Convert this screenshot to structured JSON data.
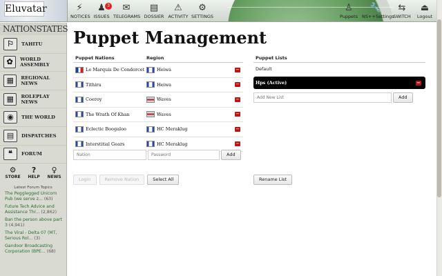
{
  "topbar": {
    "nation_name": "Eluvatar",
    "nav": [
      {
        "label": "NOTICES",
        "icon": "⚡"
      },
      {
        "label": "ISSUES",
        "icon": "♟",
        "badge": "3"
      },
      {
        "label": "TELEGRAMS",
        "icon": "✉"
      },
      {
        "label": "DOSSIER",
        "icon": "▤"
      },
      {
        "label": "ACTIVITY",
        "icon": "⚠"
      },
      {
        "label": "SETTINGS",
        "icon": "⚙"
      }
    ],
    "right_nav": [
      {
        "label": "Puppets",
        "icon": "♙"
      },
      {
        "label": "NS++Settings",
        "icon": "🔧"
      },
      {
        "label": "SWITCH",
        "icon": "⇆"
      },
      {
        "label": "Logout",
        "icon": "⏏"
      }
    ]
  },
  "sidebar": {
    "logo": "NATIONSTATES",
    "items": [
      {
        "label": "TAHITU",
        "icon": "⚐"
      },
      {
        "label": "WORLD ASSEMBLY",
        "icon": "✿"
      },
      {
        "label": "REGIONAL NEWS",
        "icon": "▦"
      },
      {
        "label": "ROLEPLAY NEWS",
        "icon": "▦"
      },
      {
        "label": "THE WORLD",
        "icon": "◉"
      },
      {
        "label": "DISPATCHES",
        "icon": "▤"
      },
      {
        "label": "FORUM",
        "icon": "❝"
      }
    ],
    "tools": [
      {
        "label": "STORE",
        "icon": "⚙"
      },
      {
        "label": "HELP",
        "icon": "?"
      },
      {
        "label": "NEWS",
        "icon": "♀"
      }
    ],
    "forum_heading": "Latest Forum Topics",
    "topics": [
      {
        "title": "The Pegglegged Unicorn Pub (we serve z...",
        "count": "(63)"
      },
      {
        "title": "Future Tech Advice and Assistance Thr...",
        "count": "(2,862)"
      },
      {
        "title": "Ban the person above part 3",
        "count": "(4,941)"
      },
      {
        "title": "The Viral - Delta 07 (MT, Serious Rol...",
        "count": "(3)"
      },
      {
        "title": "Gandoor Broadcasting Corporation (BPE...",
        "count": "(68)"
      }
    ]
  },
  "main": {
    "title": "Puppet Management",
    "table_headers": {
      "nation": "Puppet Nations",
      "region": "Region"
    },
    "puppets": [
      {
        "nation": "Le Marquis De Condorcet",
        "nation_flag": "france",
        "region": "Heiwa",
        "region_flag": "blue"
      },
      {
        "nation": "Tithiru",
        "nation_flag": "blue",
        "region": "Heiwa",
        "region_flag": "blue"
      },
      {
        "nation": "Coeroy",
        "nation_flag": "blue",
        "region": "Waves",
        "region_flag": "red"
      },
      {
        "nation": "The Wrath Of Khan",
        "nation_flag": "blue",
        "region": "Waves",
        "region_flag": "red"
      },
      {
        "nation": "Eclectic Boogaloo",
        "nation_flag": "blue",
        "region": "HC Meraklug",
        "region_flag": "blue"
      },
      {
        "nation": "Interstitial Gears",
        "nation_flag": "blue",
        "region": "HC Meraklug",
        "region_flag": "blue"
      }
    ],
    "delete_symbol": "−",
    "add_form": {
      "nation_placeholder": "Nation",
      "password_placeholder": "Password",
      "add_label": "Add"
    },
    "buttons": {
      "login": "Login",
      "remove": "Remove Nation",
      "select_all": "Select All"
    },
    "lists": {
      "header": "Puppet Lists",
      "default_label": "Default",
      "active_label": "Hps (Active)",
      "add_placeholder": "Add New List",
      "add_label": "Add",
      "rename_label": "Rename List"
    }
  }
}
